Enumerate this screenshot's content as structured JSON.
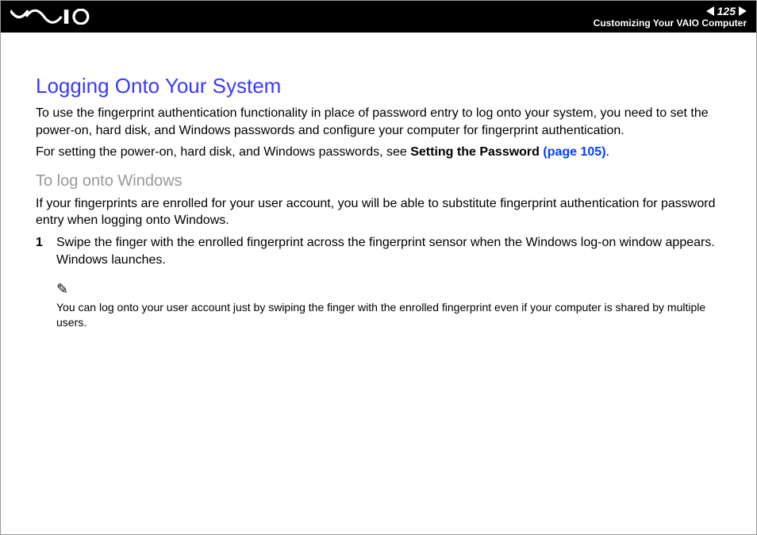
{
  "header": {
    "page_number": "125",
    "section": "Customizing Your VAIO Computer"
  },
  "title": "Logging Onto Your System",
  "intro1": "To use the fingerprint authentication functionality in place of password entry to log onto your system, you need to set the power-on, hard disk, and Windows passwords and configure your computer for fingerprint authentication.",
  "intro2_pre": "For setting the power-on, hard disk, and Windows passwords, see ",
  "intro2_bold": "Setting the Password",
  "intro2_link": "(page 105)",
  "intro2_post": ".",
  "subheading": "To log onto Windows",
  "sub_intro": "If your fingerprints are enrolled for your user account, you will be able to substitute fingerprint authentication for password entry when logging onto Windows.",
  "step_number": "1",
  "step_text": "Swipe the finger with the enrolled fingerprint across the fingerprint sensor when the Windows log-on window appears. Windows launches.",
  "note_icon": "✎",
  "note_text": "You can log onto your user account just by swiping the finger with the enrolled fingerprint even if your computer is shared by multiple users."
}
